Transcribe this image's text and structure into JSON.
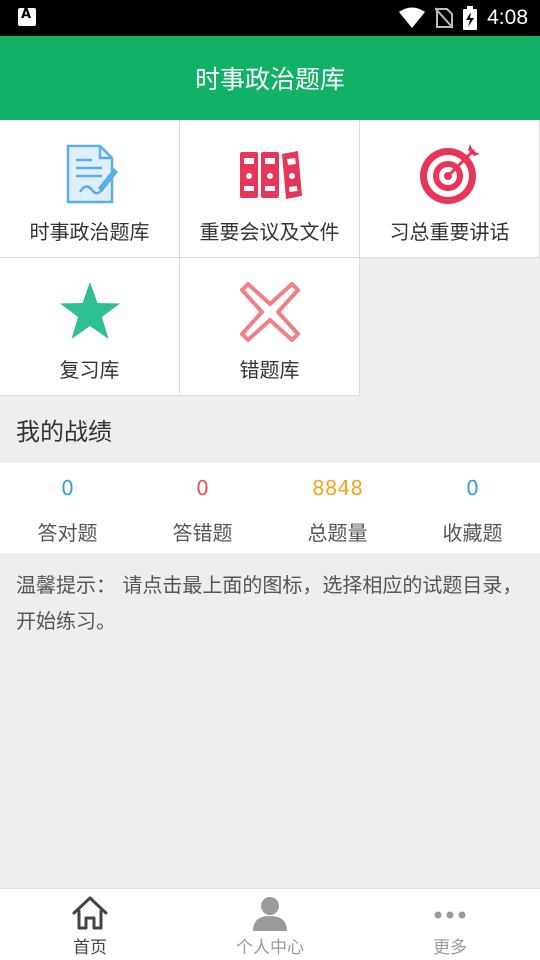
{
  "status_bar": {
    "time": "4:08"
  },
  "app_bar": {
    "title": "时事政治题库"
  },
  "menu": [
    {
      "label": "时事政治题库",
      "icon": "document-pen-icon"
    },
    {
      "label": "重要会议及文件",
      "icon": "binders-icon"
    },
    {
      "label": "习总重要讲话",
      "icon": "target-icon"
    },
    {
      "label": "复习库",
      "icon": "star-icon"
    },
    {
      "label": "错题库",
      "icon": "cross-icon"
    }
  ],
  "record": {
    "title": "我的战绩",
    "stats": [
      {
        "label": "答对题",
        "value": "0",
        "color": "#3a9bdc"
      },
      {
        "label": "答错题",
        "value": "0",
        "color": "#e94e5a"
      },
      {
        "label": "总题量",
        "value": "8848",
        "color": "#f5a623"
      },
      {
        "label": "收藏题",
        "value": "0",
        "color": "#3a9bdc"
      }
    ]
  },
  "tip": {
    "text": "温馨提示： 请点击最上面的图标，选择相应的试题目录，开始练习。"
  },
  "bottom_nav": [
    {
      "label": "首页",
      "icon": "home-icon",
      "color": "#444444"
    },
    {
      "label": "个人中心",
      "icon": "person-icon",
      "color": "#9a9a9a"
    },
    {
      "label": "更多",
      "icon": "more-dots-icon",
      "color": "#9a9a9a"
    }
  ],
  "colors": {
    "brand_green": "#12b168",
    "accent_red": "#e8365a",
    "star_teal": "#2fbf94",
    "cross_pink": "#f07f86"
  }
}
